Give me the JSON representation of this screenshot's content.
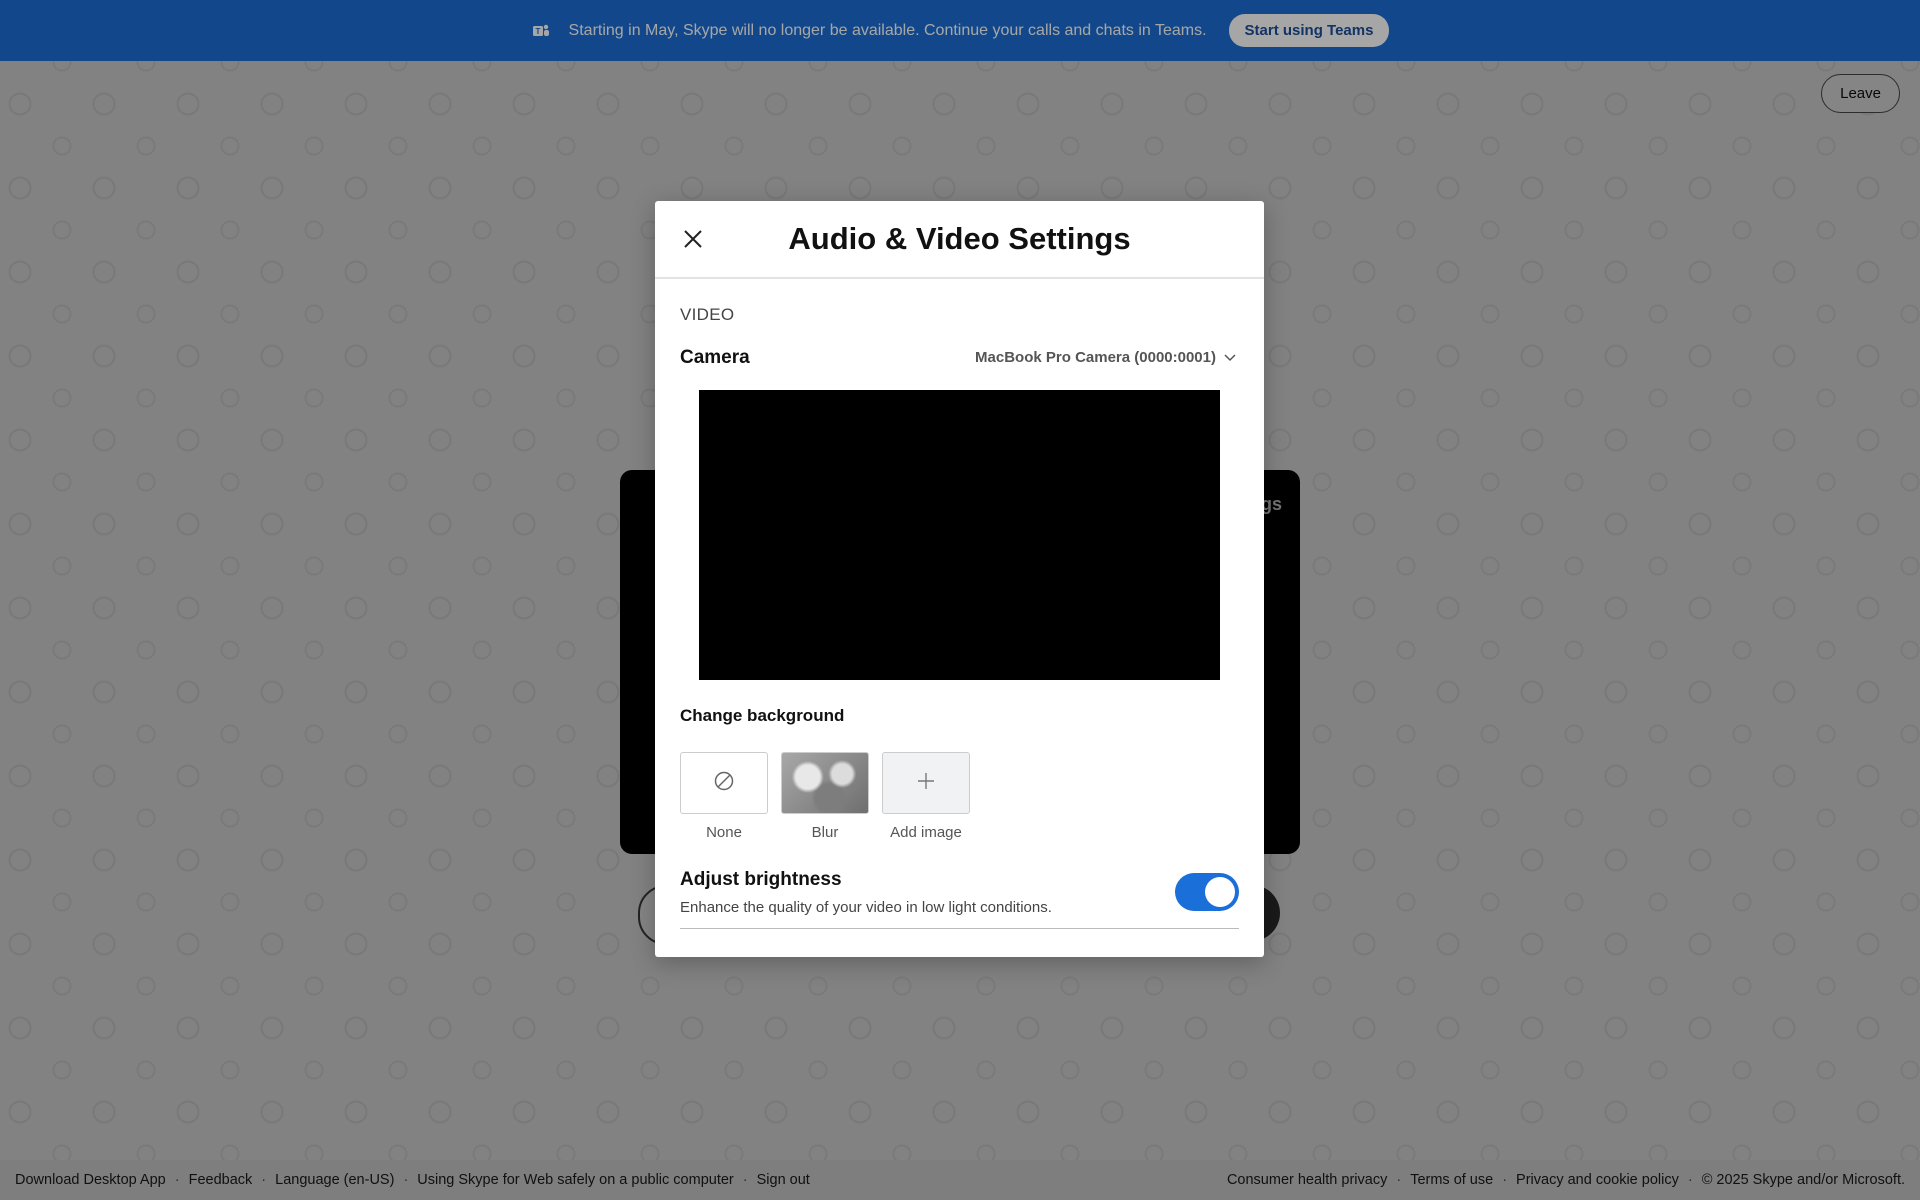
{
  "banner": {
    "message": "Starting in May, Skype will no longer be available. Continue your calls and chats in Teams.",
    "button_label": "Start using Teams",
    "icon": "teams-icon",
    "bg_color": "#1c6fd6"
  },
  "leave_label": "Leave",
  "preview": {
    "partial_label": "gs"
  },
  "modal": {
    "title": "Audio & Video Settings",
    "section": "VIDEO",
    "camera_label": "Camera",
    "camera_value": "MacBook Pro Camera (0000:0001)",
    "background_label": "Change background",
    "backgrounds": [
      {
        "label": "None",
        "icon": "no-background-icon"
      },
      {
        "label": "Blur",
        "icon": "blur-thumbnail"
      },
      {
        "label": "Add image",
        "icon": "plus-icon"
      }
    ],
    "brightness_title": "Adjust brightness",
    "brightness_desc": "Enhance the quality of your video in low light conditions.",
    "brightness_on": true,
    "accent_color": "#1a6fd8"
  },
  "footer": {
    "left_links": [
      "Download Desktop App",
      "Feedback",
      "Language (en-US)",
      "Using Skype for Web safely on a public computer",
      "Sign out"
    ],
    "right_links": [
      "Consumer health privacy",
      "Terms of use",
      "Privacy and cookie policy"
    ],
    "copyright": "© 2025 Skype and/or Microsoft."
  }
}
